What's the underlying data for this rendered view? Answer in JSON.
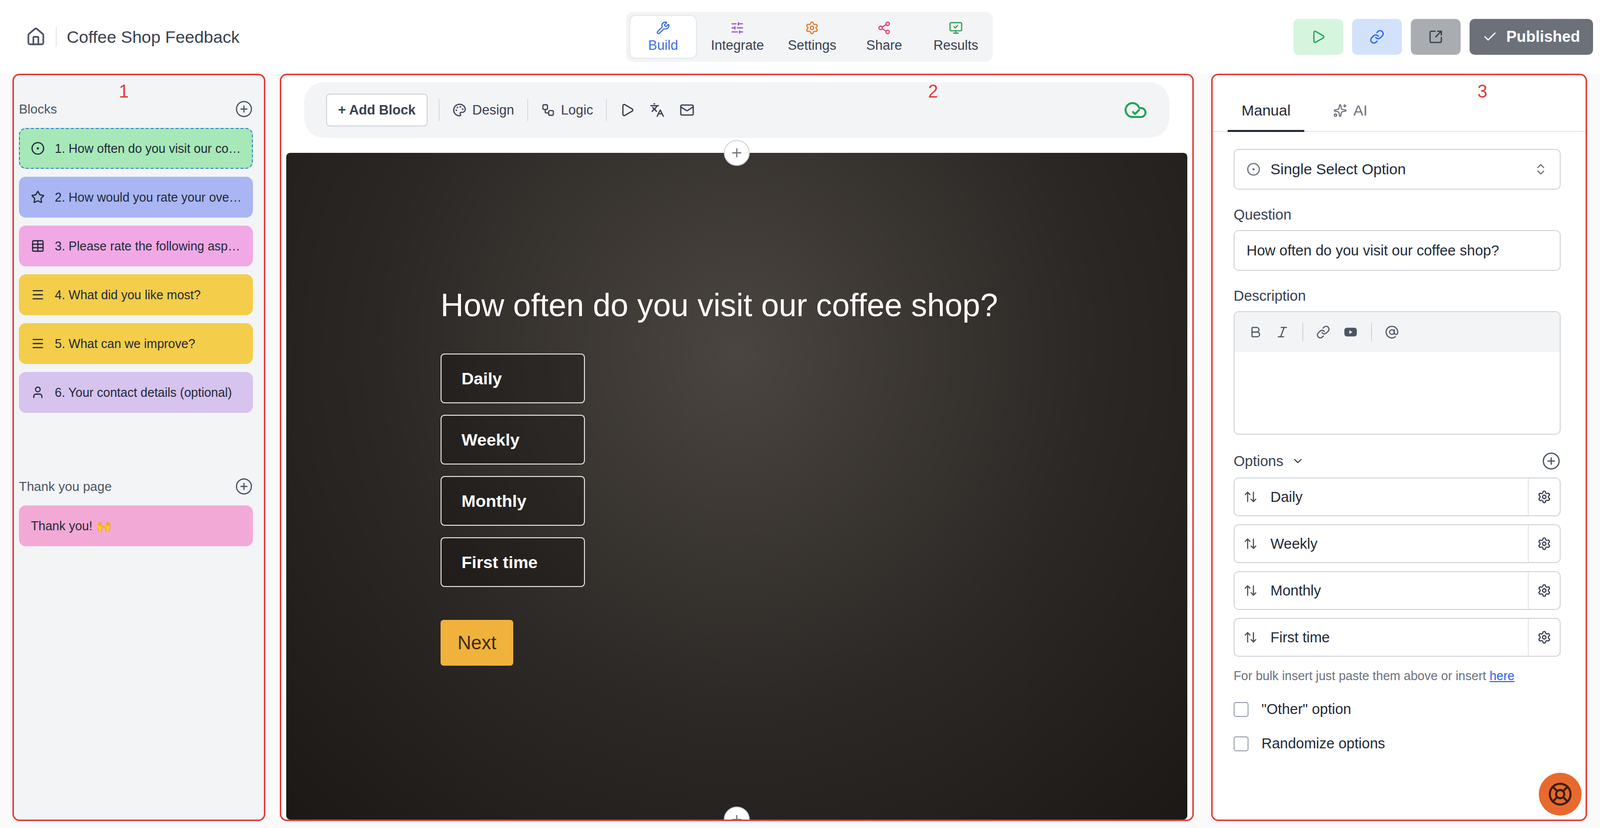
{
  "app": {
    "title": "Coffee Shop Feedback"
  },
  "nav_tabs": [
    {
      "label": "Build",
      "kind": "build",
      "selected": true,
      "color": "#3b6fd8"
    },
    {
      "label": "Integrate",
      "kind": "integrate",
      "selected": false,
      "color": "#9b4fd0"
    },
    {
      "label": "Settings",
      "kind": "settings",
      "selected": false,
      "color": "#e07b2f"
    },
    {
      "label": "Share",
      "kind": "share",
      "selected": false,
      "color": "#e0457f"
    },
    {
      "label": "Results",
      "kind": "results",
      "selected": false,
      "color": "#2f9e55"
    }
  ],
  "publish_button": {
    "label": "Published"
  },
  "annotations": [
    "1",
    "2",
    "3"
  ],
  "blocks": {
    "label": "Blocks",
    "items": [
      {
        "text": "1. How often do you visit our co…",
        "kind": "single-select",
        "color": "#a7e8b8",
        "selected": true
      },
      {
        "text": "2. How would you rate your ove…",
        "kind": "rating",
        "color": "#a9b6f3",
        "selected": false
      },
      {
        "text": "3. Please rate the following asp…",
        "kind": "matrix",
        "color": "#f1a9e6",
        "selected": false
      },
      {
        "text": "4. What did you like most?",
        "kind": "text",
        "color": "#f4cd4a",
        "selected": false
      },
      {
        "text": "5. What can we improve?",
        "kind": "text",
        "color": "#f4cd4a",
        "selected": false
      },
      {
        "text": "6. Your contact details (optional)",
        "kind": "contact",
        "color": "#d6c3ee",
        "selected": false
      }
    ]
  },
  "thank_you": {
    "label": "Thank you page",
    "items": [
      {
        "text": "Thank you! 🙌",
        "color": "#f2a9d6",
        "selected": false
      }
    ]
  },
  "toolbar": {
    "add_block": "+ Add Block",
    "items": [
      "Design",
      "Logic"
    ],
    "saved": true
  },
  "preview": {
    "question": "How often do you visit our coffee shop?",
    "options": [
      {
        "label": "Daily",
        "selected": false
      },
      {
        "label": "Weekly",
        "selected": false
      },
      {
        "label": "Monthly",
        "selected": false
      },
      {
        "label": "First time",
        "selected": false
      }
    ],
    "next": "Next"
  },
  "editor": {
    "tabs": [
      {
        "label": "Manual",
        "selected": true
      },
      {
        "label": "AI",
        "selected": false
      }
    ],
    "type": "Single Select Option",
    "question_label": "Question",
    "question": "How often do you visit our coffee shop?",
    "description_label": "Description",
    "description": "",
    "options_label": "Options",
    "options": [
      "Daily",
      "Weekly",
      "Monthly",
      "First time"
    ],
    "bulk_text": "For bulk insert just paste them above or insert",
    "bulk_link": "here",
    "checkboxes": [
      {
        "label": "\"Other\" option",
        "checked": false
      },
      {
        "label": "Randomize options",
        "checked": false
      }
    ]
  }
}
